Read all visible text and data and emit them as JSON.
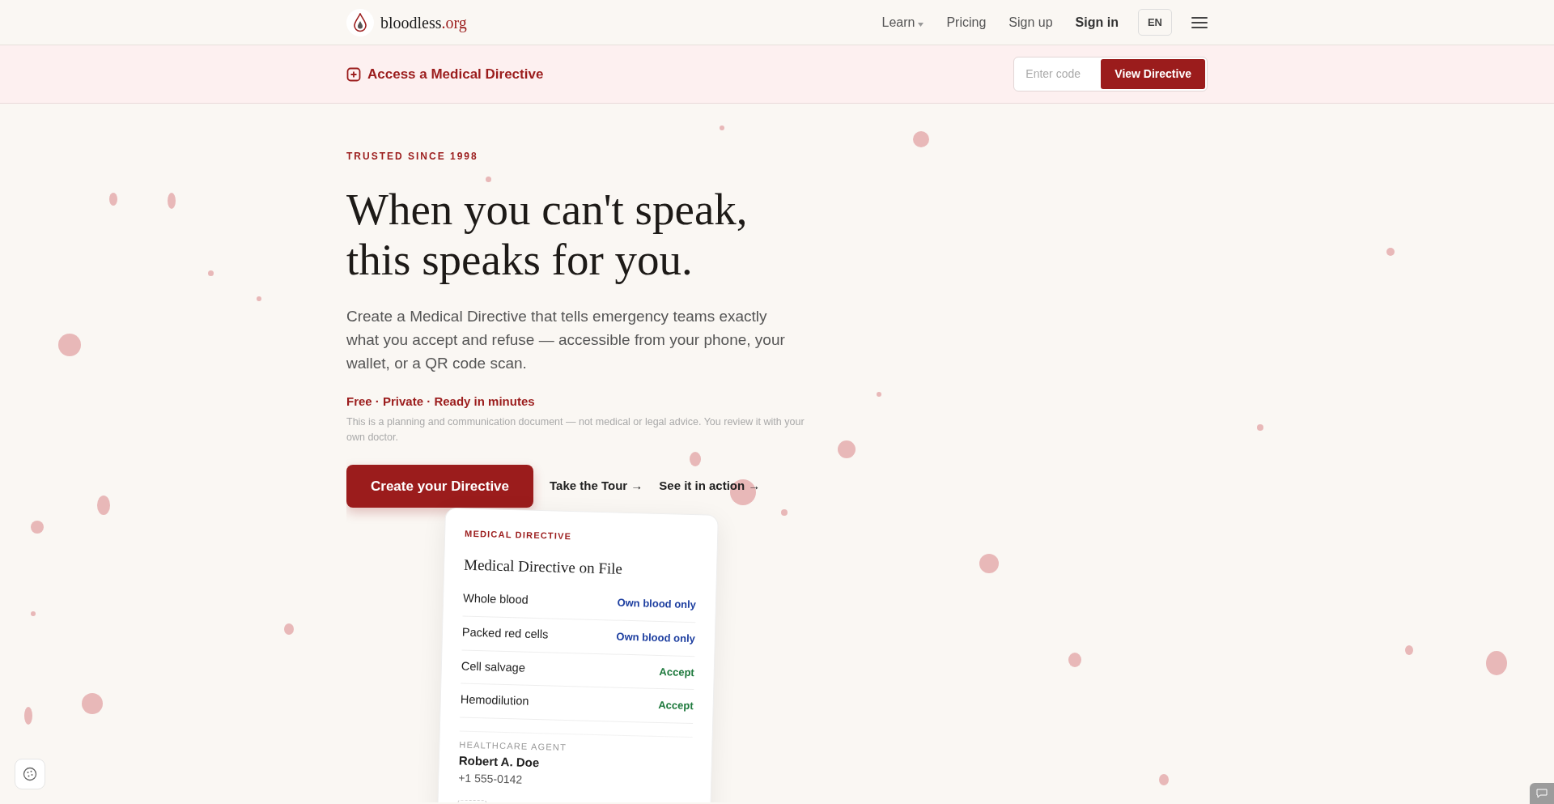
{
  "brand": {
    "name": "bloodless",
    "tld": ".org"
  },
  "nav": [
    {
      "label": "Learn",
      "dropdown": true,
      "bold": false
    },
    {
      "label": "Pricing",
      "dropdown": false,
      "bold": false
    },
    {
      "label": "Sign up",
      "dropdown": false,
      "bold": false
    },
    {
      "label": "Sign in",
      "dropdown": false,
      "bold": true
    }
  ],
  "language": "EN",
  "banner": {
    "title": "Access a Medical Directive",
    "placeholder": "Enter code",
    "button": "View Directive"
  },
  "hero": {
    "eyebrow": "TRUSTED SINCE 1998",
    "headline_lines": [
      "When you can't speak,",
      "this speaks for you."
    ],
    "lead": "Create a Medical Directive that tells emergency teams exactly what you accept and refuse — accessible from your phone, your wallet, or a QR code scan.",
    "tagline": "Free · Private · Ready in minutes",
    "disclaimer": "This is a planning and communication document — not medical or legal advice. You review it with your own doctor.",
    "primary_button": "Create your Directive",
    "links": [
      "Take the Tour →",
      "See it in action →"
    ]
  },
  "card": {
    "eyebrow": "MEDICAL DIRECTIVE",
    "title": "Medical Directive on File",
    "rows": [
      {
        "label": "Whole blood",
        "value": "Own blood only",
        "kind": "limited"
      },
      {
        "label": "Packed red cells",
        "value": "Own blood only",
        "kind": "limited"
      },
      {
        "label": "Cell salvage",
        "value": "Accept",
        "kind": "accept"
      },
      {
        "label": "Hemodilution",
        "value": "Accept",
        "kind": "accept"
      }
    ],
    "agent_label": "HEALTHCARE AGENT",
    "agent_name": "Robert A. Doe",
    "agent_phone": "+1 555-0142"
  }
}
